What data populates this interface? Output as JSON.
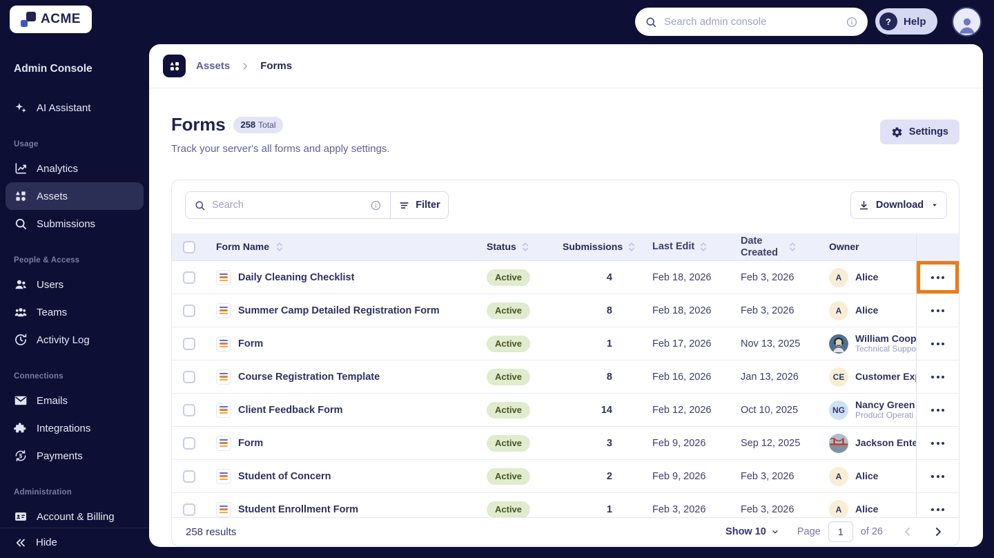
{
  "topbar": {
    "logo_text": "ACME",
    "search_placeholder": "Search admin console",
    "help_label": "Help",
    "help_icon_glyph": "?"
  },
  "sidebar": {
    "title": "Admin Console",
    "assistant": {
      "label": "AI Assistant",
      "icon": "sparkles"
    },
    "sections": [
      {
        "label": "Usage",
        "items": [
          {
            "label": "Analytics",
            "icon": "chart",
            "active": false
          },
          {
            "label": "Assets",
            "icon": "grid",
            "active": true
          },
          {
            "label": "Submissions",
            "icon": "search",
            "active": false
          }
        ]
      },
      {
        "label": "People & Access",
        "items": [
          {
            "label": "Users",
            "icon": "person",
            "active": false
          },
          {
            "label": "Teams",
            "icon": "people",
            "active": false
          },
          {
            "label": "Activity Log",
            "icon": "clock",
            "active": false
          }
        ]
      },
      {
        "label": "Connections",
        "items": [
          {
            "label": "Emails",
            "icon": "mail",
            "active": false
          },
          {
            "label": "Integrations",
            "icon": "puzzle",
            "active": false
          },
          {
            "label": "Payments",
            "icon": "dollar",
            "active": false
          }
        ]
      },
      {
        "label": "Administration",
        "items": [
          {
            "label": "Account & Billing",
            "icon": "idcard",
            "active": false
          }
        ]
      }
    ],
    "hide_label": "Hide"
  },
  "breadcrumb": {
    "parent": "Assets",
    "current": "Forms"
  },
  "page_header": {
    "title": "Forms",
    "badge_count": "258",
    "badge_suffix": "Total",
    "subtitle": "Track your server's all forms and apply settings.",
    "settings_label": "Settings"
  },
  "table_controls": {
    "search_placeholder": "Search",
    "filter_label": "Filter",
    "download_label": "Download"
  },
  "table": {
    "columns": [
      {
        "label": "Form Name",
        "sortable": true
      },
      {
        "label": "Status",
        "sortable": true
      },
      {
        "label": "Submissions",
        "sortable": true
      },
      {
        "label": "Last Edit",
        "sortable": true
      },
      {
        "label": "Date Created",
        "sortable": true
      },
      {
        "label": "Owner",
        "sortable": false
      }
    ],
    "rows": [
      {
        "name": "Daily Cleaning Checklist",
        "status": "Active",
        "submissions": "4",
        "last_edit": "Feb 18, 2026",
        "date_created": "Feb 3, 2026",
        "owner": {
          "type": "initials",
          "initials": "A",
          "bg": "cream",
          "name": "Alice",
          "subtitle": ""
        },
        "highlighted": true
      },
      {
        "name": "Summer Camp Detailed Registration Form",
        "status": "Active",
        "submissions": "8",
        "last_edit": "Feb 18, 2026",
        "date_created": "Feb 3, 2026",
        "owner": {
          "type": "initials",
          "initials": "A",
          "bg": "cream",
          "name": "Alice",
          "subtitle": ""
        },
        "highlighted": false
      },
      {
        "name": "Form",
        "status": "Active",
        "submissions": "1",
        "last_edit": "Feb 17, 2026",
        "date_created": "Nov 13, 2025",
        "owner": {
          "type": "photo-support",
          "initials": "",
          "bg": "",
          "name": "William Coope",
          "subtitle": "Technical Suppo"
        },
        "highlighted": false
      },
      {
        "name": "Course Registration Template",
        "status": "Active",
        "submissions": "8",
        "last_edit": "Feb 16, 2026",
        "date_created": "Jan 13, 2026",
        "owner": {
          "type": "initials",
          "initials": "CE",
          "bg": "cream",
          "name": "Customer Exp",
          "subtitle": ""
        },
        "highlighted": false
      },
      {
        "name": "Client Feedback Form",
        "status": "Active",
        "submissions": "14",
        "last_edit": "Feb 12, 2026",
        "date_created": "Oct 10, 2025",
        "owner": {
          "type": "initials",
          "initials": "NG",
          "bg": "blue",
          "name": "Nancy Green",
          "subtitle": "Product Operati"
        },
        "highlighted": false
      },
      {
        "name": "Form",
        "status": "Active",
        "submissions": "3",
        "last_edit": "Feb 9, 2026",
        "date_created": "Sep 12, 2025",
        "owner": {
          "type": "photo-bridge",
          "initials": "",
          "bg": "",
          "name": "Jackson Enter",
          "subtitle": ""
        },
        "highlighted": false
      },
      {
        "name": "Student of Concern",
        "status": "Active",
        "submissions": "2",
        "last_edit": "Feb 9, 2026",
        "date_created": "Feb 3, 2026",
        "owner": {
          "type": "initials",
          "initials": "A",
          "bg": "cream",
          "name": "Alice",
          "subtitle": ""
        },
        "highlighted": false
      },
      {
        "name": "Student Enrollment Form",
        "status": "Active",
        "submissions": "1",
        "last_edit": "Feb 3, 2026",
        "date_created": "Feb 3, 2026",
        "owner": {
          "type": "initials",
          "initials": "A",
          "bg": "cream",
          "name": "Alice",
          "subtitle": ""
        },
        "highlighted": false
      }
    ]
  },
  "footer": {
    "results": "258 results",
    "show_label": "Show 10",
    "page_label": "Page",
    "page_value": "1",
    "of_label": "of 26"
  },
  "colors": {
    "dark_navy_bg": "#0d1034",
    "active_sidebar_item": "#2c2f55",
    "accent_navy_text": "#23275a",
    "lavender_pill": "#dfe2f6",
    "header_row_bg": "#edeffa",
    "status_active_bg": "#dfeccd",
    "status_active_text": "#4a5524",
    "highlight_orange": "#ee7b12",
    "avatar_cream": "#f8eed6",
    "avatar_blue": "#cde1f3",
    "doc_bar_blue": "#4b6fd8",
    "doc_bar_orange": "#ec7c2c",
    "doc_bar_amber": "#f3a93e"
  }
}
